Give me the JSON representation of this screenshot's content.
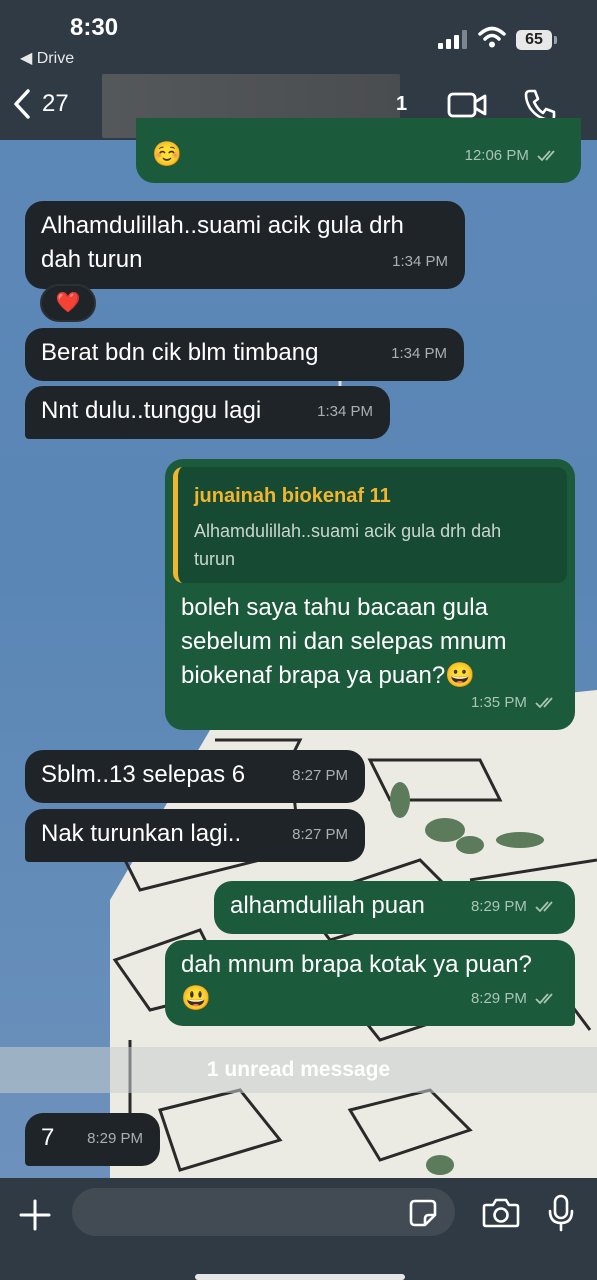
{
  "status_bar": {
    "time": "8:30",
    "back_app": "◀ Drive",
    "battery": "65"
  },
  "header": {
    "unread_count": "27",
    "contact_suffix": "1"
  },
  "messages": [
    {
      "dir": "out",
      "text": "☺️",
      "time": "12:06 PM"
    },
    {
      "dir": "in",
      "text": "Alhamdulillah..suami acik gula drh dah turun",
      "time": "1:34 PM"
    },
    {
      "dir": "in",
      "text": "Berat bdn cik blm timbang",
      "time": "1:34 PM"
    },
    {
      "dir": "in",
      "text": "Nnt dulu..tunggu lagi",
      "time": "1:34 PM"
    },
    {
      "dir": "out",
      "text": "boleh saya tahu bacaan gula sebelum ni dan selepas mnum biokenaf brapa ya puan?😀",
      "time": "1:35 PM"
    },
    {
      "dir": "in",
      "text": "Sblm..13 selepas 6",
      "time": "8:27 PM"
    },
    {
      "dir": "in",
      "text": "Nak turunkan lagi..",
      "time": "8:27 PM"
    },
    {
      "dir": "out",
      "text": "alhamdulilah puan",
      "time": "8:29 PM"
    },
    {
      "dir": "out",
      "text": "dah mnum brapa kotak ya puan?😃",
      "time": "8:29 PM"
    },
    {
      "dir": "in",
      "text": "7",
      "time": "8:29 PM"
    }
  ],
  "reaction": "❤️",
  "reply_quote": {
    "author": "junainah biokenaf 11",
    "text": "Alhamdulillah..suami acik gula drh dah turun"
  },
  "msg4_lines": [
    "boleh saya tahu bacaan gula",
    "sebelum ni dan selepas mnum",
    "biokenaf brapa ya puan?😀"
  ],
  "msg1_lines": [
    "Alhamdulillah..suami acik gula drh",
    "dah turun"
  ],
  "msg8_lines": [
    "dah mnum brapa kotak ya puan?",
    "😃"
  ],
  "quote_lines": [
    "Alhamdulillah..suami acik gula drh dah",
    "turun"
  ],
  "unread_banner": "1 unread message",
  "composer": {
    "placeholder": ""
  },
  "colors": {
    "incoming_bubble": "#1f2428",
    "outgoing_bubble": "#1c5a3c",
    "quote_accent": "#f2b530",
    "bars": "#2f3a44"
  }
}
